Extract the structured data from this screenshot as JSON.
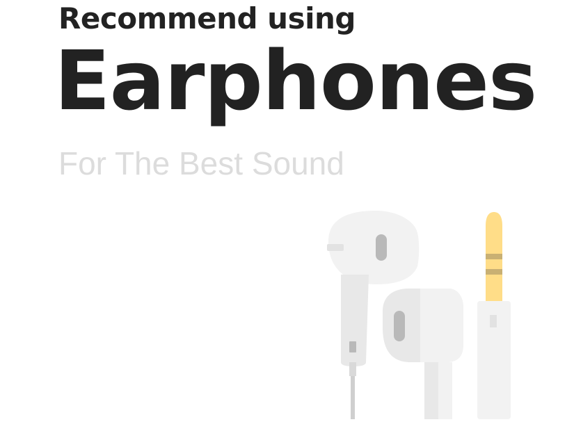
{
  "intro": {
    "line1": "Recommend using",
    "headline": "Earphones",
    "tagline": "For The Best Sound"
  },
  "illustration": {
    "icon": "earphones-icon",
    "colors": {
      "bud_light": "#f2f2f2",
      "bud_mid": "#e8e8e8",
      "bud_dark": "#d9d9d9",
      "grill": "#b9b9b9",
      "plug_tip": "#ffdd88",
      "plug_ring": "#c9b073"
    }
  }
}
